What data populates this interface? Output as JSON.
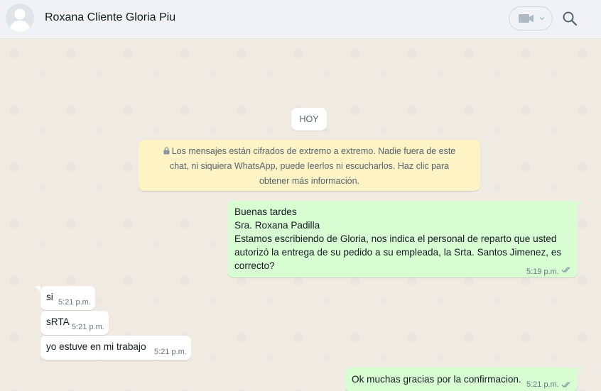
{
  "header": {
    "contact_name": "Roxana Cliente Gloria Piu",
    "icons": [
      "avatar-placeholder",
      "video-call-icon",
      "chevron-down-icon",
      "search-icon"
    ]
  },
  "chat": {
    "date_chip": "HOY",
    "encryption_notice": {
      "line1": "Los mensajes están cifrados de extremo a extremo. Nadie fuera de este",
      "line2": "chat, ni siquiera WhatsApp, puede leerlos ni escucharlos. Haz clic para",
      "line3": "obtener más información."
    },
    "messages": [
      {
        "direction": "out",
        "lines": [
          "Buenas tardes",
          "Sra. Roxana Padilla",
          "Estamos escribiendo de Gloria, nos indica el personal de reparto que usted",
          "autorizó la entrega de su pedido a su empleada, la Srta. Santos Jimenez, es",
          "correcto?"
        ],
        "time": "5:19 p.m.",
        "status": "read"
      },
      {
        "direction": "in",
        "text": "si",
        "time": "5:21 p.m."
      },
      {
        "direction": "in",
        "text": "sRTA",
        "time": "5:21 p.m."
      },
      {
        "direction": "in",
        "text": "yo estuve en mi trabajo",
        "time": "5:21 p.m."
      },
      {
        "direction": "out",
        "text": "Ok muchas gracias por la confirmacion.",
        "time": "5:21 p.m.",
        "status": "read"
      }
    ]
  },
  "colors": {
    "outgoing_bubble": "#d9fdd3",
    "incoming_bubble": "#ffffff",
    "notice_bg": "#fdf3c5",
    "header_bg": "#f0f2f5",
    "chat_bg": "#efeae2",
    "tick_color": "#8696a0"
  }
}
